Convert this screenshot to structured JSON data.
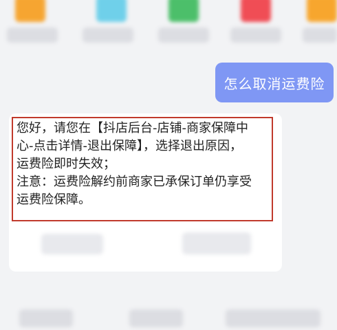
{
  "top_tiles": [
    {
      "color": "#f6a531"
    },
    {
      "color": "#6fd0ea"
    },
    {
      "color": "#4cbf6a"
    },
    {
      "color": "#f04d55"
    },
    {
      "color": "#f7a62e"
    }
  ],
  "user_message": "怎么取消运费险",
  "bot_message": {
    "lines": [
      "您好，请您在【抖店后台-店铺-商家保障中",
      "心-点击详情-退出保障】，选择退出原因，",
      "运费险即时失效；",
      "注意：运费险解约前商家已承保订单仍享受",
      "运费险保障。"
    ]
  },
  "colors": {
    "user_bubble": "#7f97f4",
    "highlight_border": "#c0392b",
    "page_background": "#f2f3f5"
  }
}
